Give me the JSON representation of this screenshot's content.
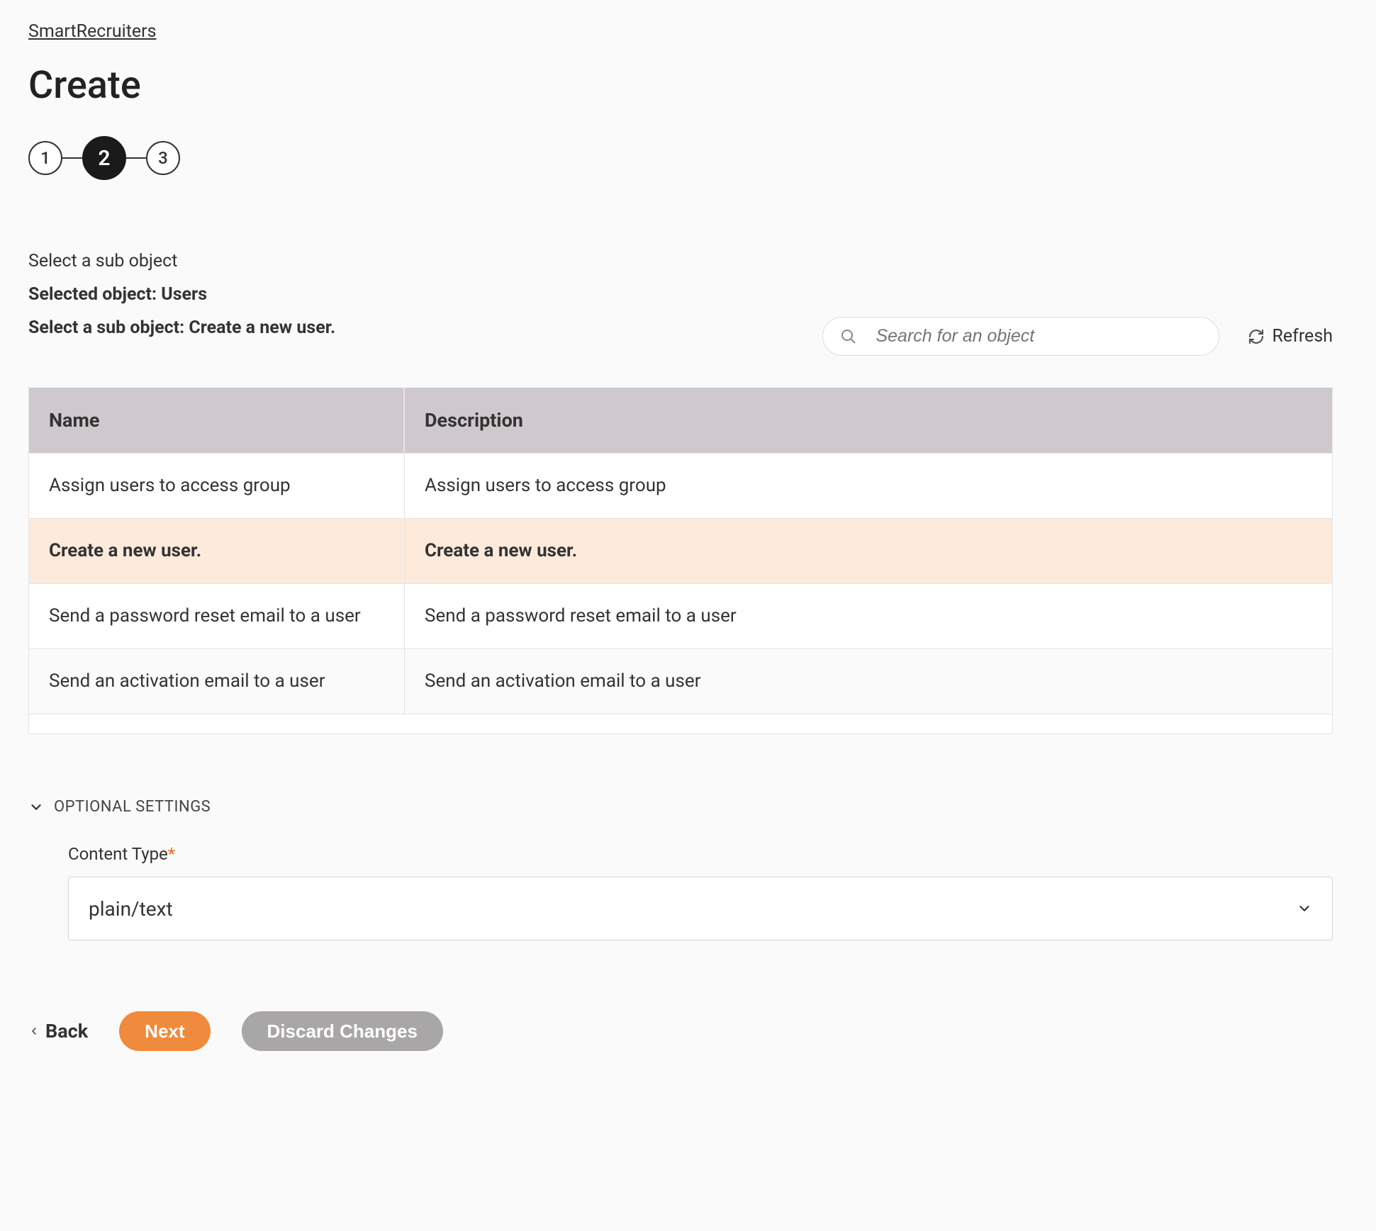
{
  "breadcrumb": "SmartRecruiters",
  "title": "Create",
  "steps": [
    "1",
    "2",
    "3"
  ],
  "active_step_index": 1,
  "info": {
    "select_label": "Select a sub object",
    "selected_prefix": "Selected object: ",
    "selected_value": "Users",
    "sub_prefix": "Select a sub object: ",
    "sub_value": "Create a new user."
  },
  "search": {
    "placeholder": "Search for an object"
  },
  "refresh_label": "Refresh",
  "table": {
    "headers": {
      "name": "Name",
      "description": "Description"
    },
    "rows": [
      {
        "name": "Assign users to access group",
        "description": "Assign users to access group",
        "selected": false
      },
      {
        "name": "Create a new user.",
        "description": "Create a new user.",
        "selected": true
      },
      {
        "name": "Send a password reset email to a user",
        "description": "Send a password reset email to a user",
        "selected": false
      },
      {
        "name": "Send an activation email to a user",
        "description": "Send an activation email to a user",
        "selected": false
      }
    ]
  },
  "optional": {
    "section_label": "OPTIONAL SETTINGS",
    "content_type_label": "Content Type",
    "content_type_value": "plain/text"
  },
  "buttons": {
    "back": "Back",
    "next": "Next",
    "discard": "Discard Changes"
  }
}
